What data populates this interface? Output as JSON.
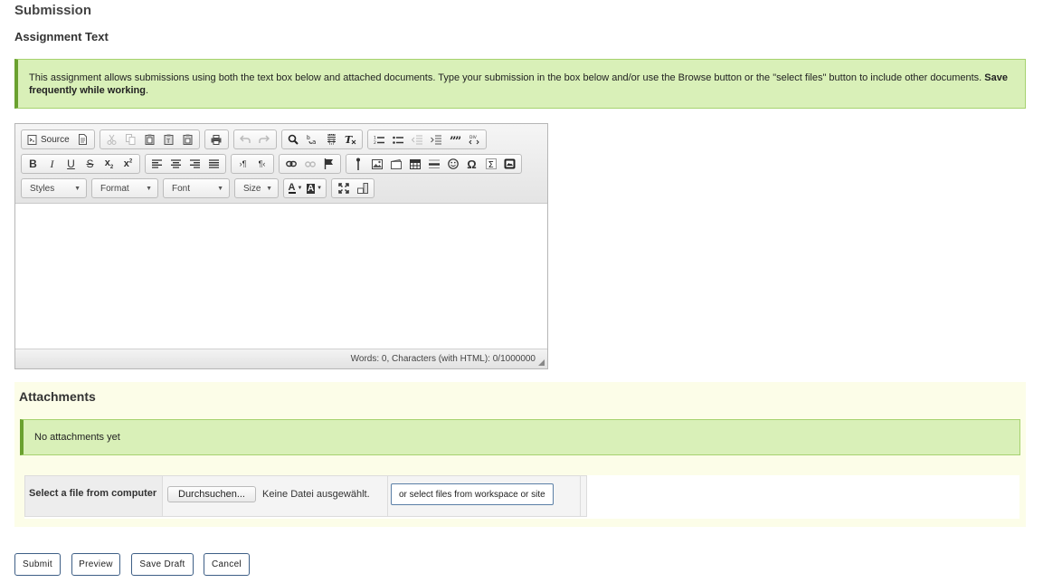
{
  "page": {
    "title": "Submission",
    "section_title": "Assignment Text",
    "info_text": "This assignment allows submissions using both the text box below and attached documents. Type your submission in the box below and/or use the Browse button or the \"select files\" button to include other documents.",
    "info_bold": "Save frequently while working",
    "info_end": "."
  },
  "editor": {
    "source_label": "Source",
    "combos": [
      "Styles",
      "Format",
      "Font",
      "Size"
    ],
    "word_count": "Words: 0, Characters (with HTML): 0/1000000"
  },
  "attachments": {
    "title": "Attachments",
    "empty_text": "No attachments yet",
    "file_label": "Select a file from computer",
    "browse_label": "Durchsuchen...",
    "no_file_text": "Keine Datei ausgewählt.",
    "select_files_label": "or select files from workspace or site"
  },
  "actions": {
    "submit": "Submit",
    "preview": "Preview",
    "save_draft": "Save Draft",
    "cancel": "Cancel"
  }
}
